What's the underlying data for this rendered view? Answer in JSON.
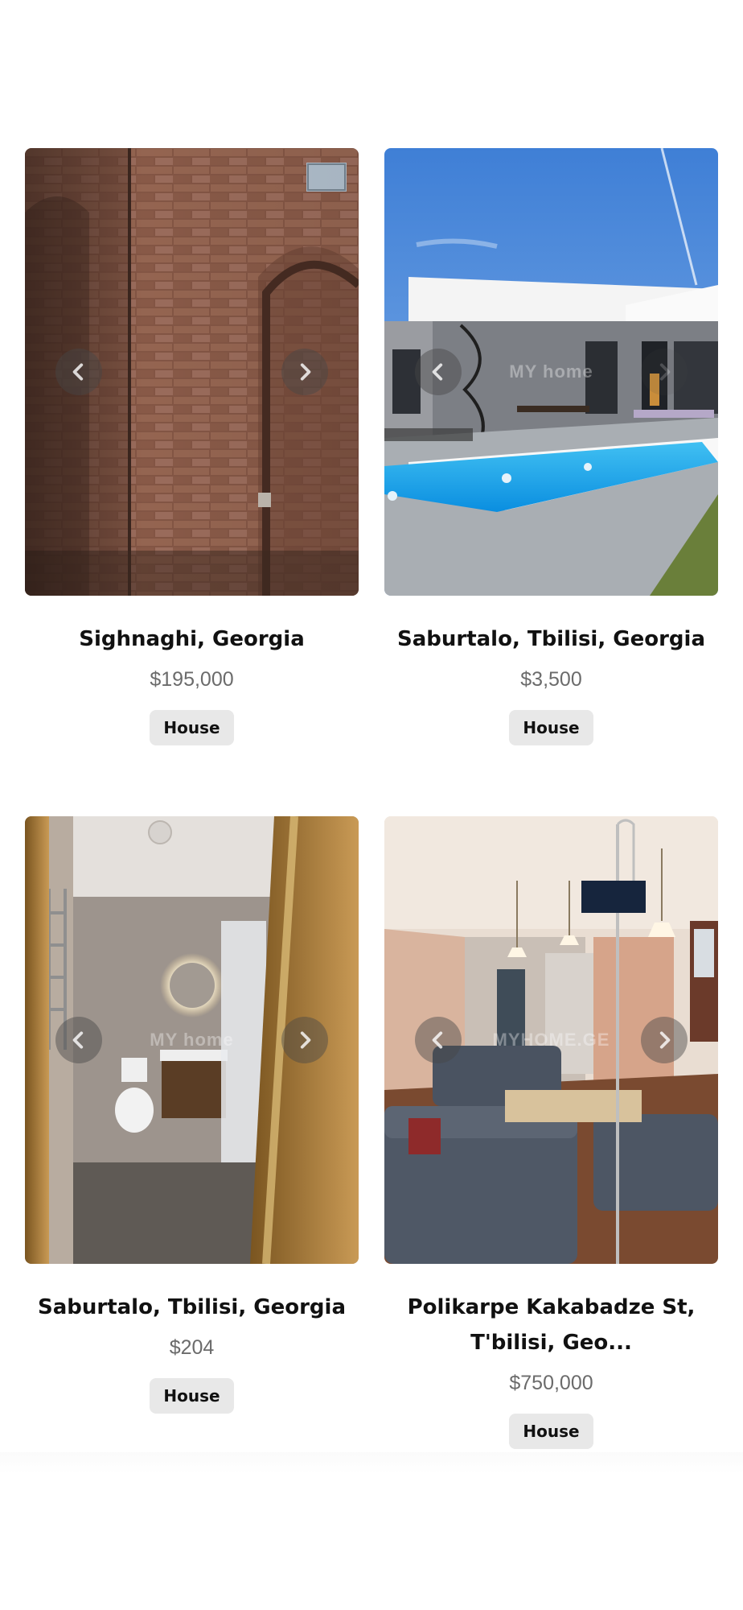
{
  "listings": [
    {
      "location": "Sighnaghi, Georgia",
      "price": "$195,000",
      "type": "House",
      "photo_subject": "brick-interior",
      "watermark": ""
    },
    {
      "location": "Saburtalo, Tbilisi, Georgia",
      "price": "$3,500",
      "type": "House",
      "photo_subject": "modern-house-pool",
      "watermark": "MY home"
    },
    {
      "location": "Saburtalo, Tbilisi, Georgia",
      "price": "$204",
      "type": "House",
      "photo_subject": "bathroom",
      "watermark": "MY home"
    },
    {
      "location": "Polikarpe Kakabadze St, T'bilisi, Geo...",
      "price": "$750,000",
      "type": "House",
      "photo_subject": "living-room",
      "watermark": "MYHOME.GE"
    }
  ],
  "icons": {
    "prev": "chevron-left-icon",
    "next": "chevron-right-icon"
  },
  "colors": {
    "title": "#111111",
    "price": "#6b6b6b",
    "badge_bg": "#e8e8e8"
  }
}
